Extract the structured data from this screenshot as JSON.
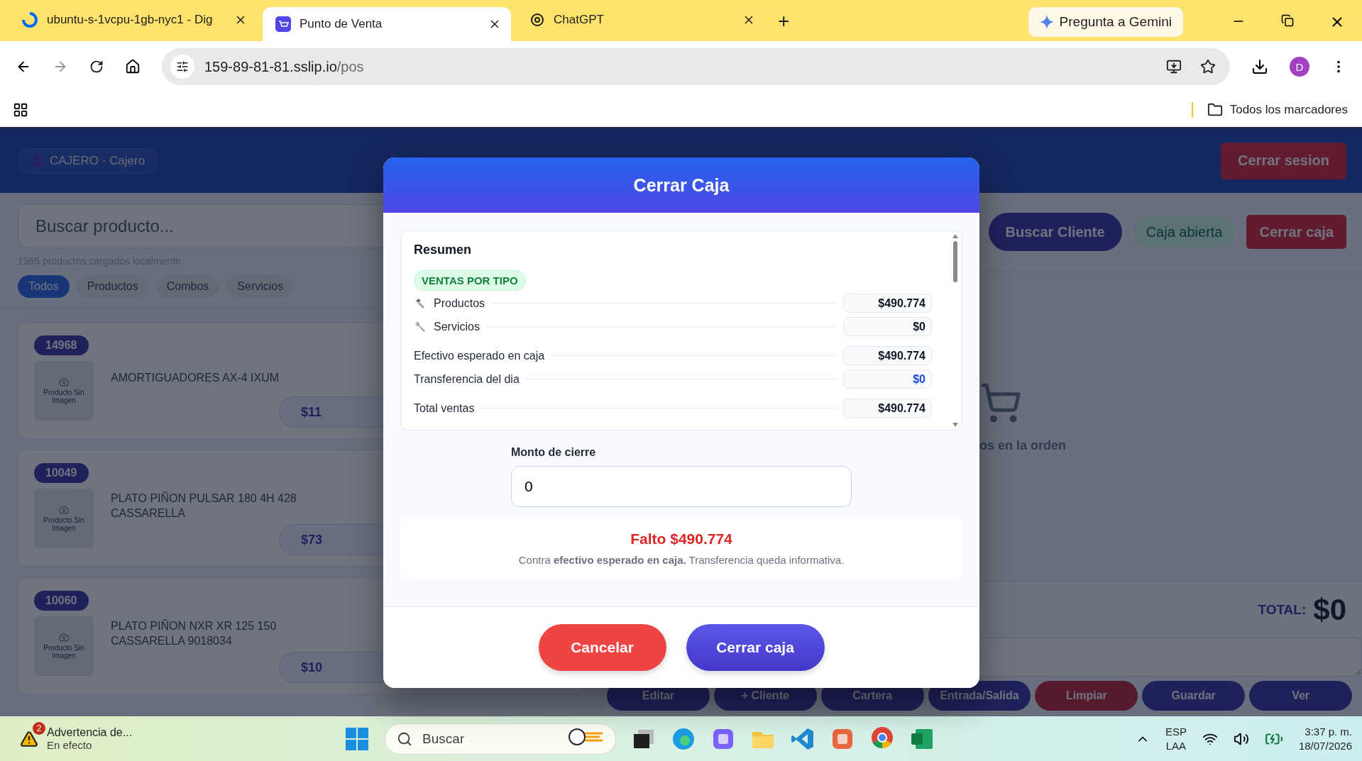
{
  "browser": {
    "tabs": [
      {
        "title": "ubuntu-s-1vcpu-1gb-nyc1 - Dig",
        "kind": "spinner",
        "selected": false
      },
      {
        "title": "Punto de Venta",
        "kind": "cart",
        "selected": true
      },
      {
        "title": "ChatGPT",
        "kind": "knot",
        "selected": false
      }
    ],
    "new_tab": "+",
    "assistant": "Pregunta a Gemini",
    "address": {
      "host": "159-89-81-81.sslip.io",
      "path": "/pos"
    },
    "profile": "D",
    "bookmarks": "Todos los marcadores"
  },
  "app": {
    "user": "CAJERO · Cajero",
    "logout": "Cerrar sesion",
    "search": {
      "placeholder": "Buscar producto..."
    },
    "count": "1365 productos cargados localmente",
    "filters": [
      {
        "label": "Todos",
        "selected": true
      },
      {
        "label": "Productos",
        "selected": false
      },
      {
        "label": "Combos",
        "selected": false
      },
      {
        "label": "Servicios",
        "selected": false
      }
    ],
    "products": [
      {
        "code": "14968",
        "name": "AMORTIGUADORES AX-4 IXUM",
        "image_text": "Producto Sin Imagen",
        "price": "$11"
      },
      {
        "code": "10049",
        "name": "PLATO PIÑON PULSAR 180 4H 428 CASSARELLA",
        "image_text": "Producto Sin Imagen",
        "price": "$73"
      },
      {
        "code": "10060",
        "name": "PLATO PIÑON NXR XR 125 150 CASSARELLA 9018034",
        "image_text": "Producto Sin Imagen",
        "price": "$10"
      }
    ],
    "toolbar": {
      "search_client": "Buscar Cliente",
      "status": "Caja abierta",
      "close": "Cerrar caja"
    },
    "empty_text": "os en la orden",
    "total_label": "TOTAL:",
    "total": "$0",
    "actions": [
      {
        "label": "Editar",
        "kind": "primary"
      },
      {
        "label": "+ Cliente",
        "kind": "primary"
      },
      {
        "label": "Cartera",
        "kind": "primary"
      },
      {
        "label": "Entrada/Salida",
        "kind": "primary"
      },
      {
        "label": "Limpiar",
        "kind": "danger"
      },
      {
        "label": "Guardar",
        "kind": "primary"
      },
      {
        "label": "Ver",
        "kind": "primary"
      }
    ]
  },
  "modal": {
    "title": "Cerrar Caja",
    "summary_title": "Resumen",
    "badge": "VENTAS POR TIPO",
    "rows": [
      {
        "label": "Productos",
        "value": "$490.774",
        "kind": "bolt",
        "color": "#111827"
      },
      {
        "label": "Servicios",
        "value": "$0",
        "kind": "wrench",
        "color": "#111827"
      },
      {
        "label": "Efectivo esperado en caja",
        "value": "$490.774",
        "kind": "plain",
        "color": "#111827"
      },
      {
        "label": "Transferencia del dia",
        "value": "$0",
        "kind": "plain",
        "color": "#1d4ed8"
      },
      {
        "label": "Total ventas",
        "value": "$490.774",
        "kind": "plain",
        "color": "#111827"
      }
    ],
    "amount_label": "Monto de cierre",
    "amount_value": "0",
    "result": "Falto $490.774",
    "note": "Contra **efectivo esperado en caja.** Transferencia queda informativa.",
    "cancel": "Cancelar",
    "confirm": "Cerrar caja"
  },
  "taskbar": {
    "notice_title": "Advertencia de...",
    "notice_sub": "En efecto",
    "notice_count": "2",
    "search": "Buscar",
    "lang": "ESP",
    "layout": "LAA",
    "time": "3:37 p. m.",
    "date": "18/07/2026"
  }
}
